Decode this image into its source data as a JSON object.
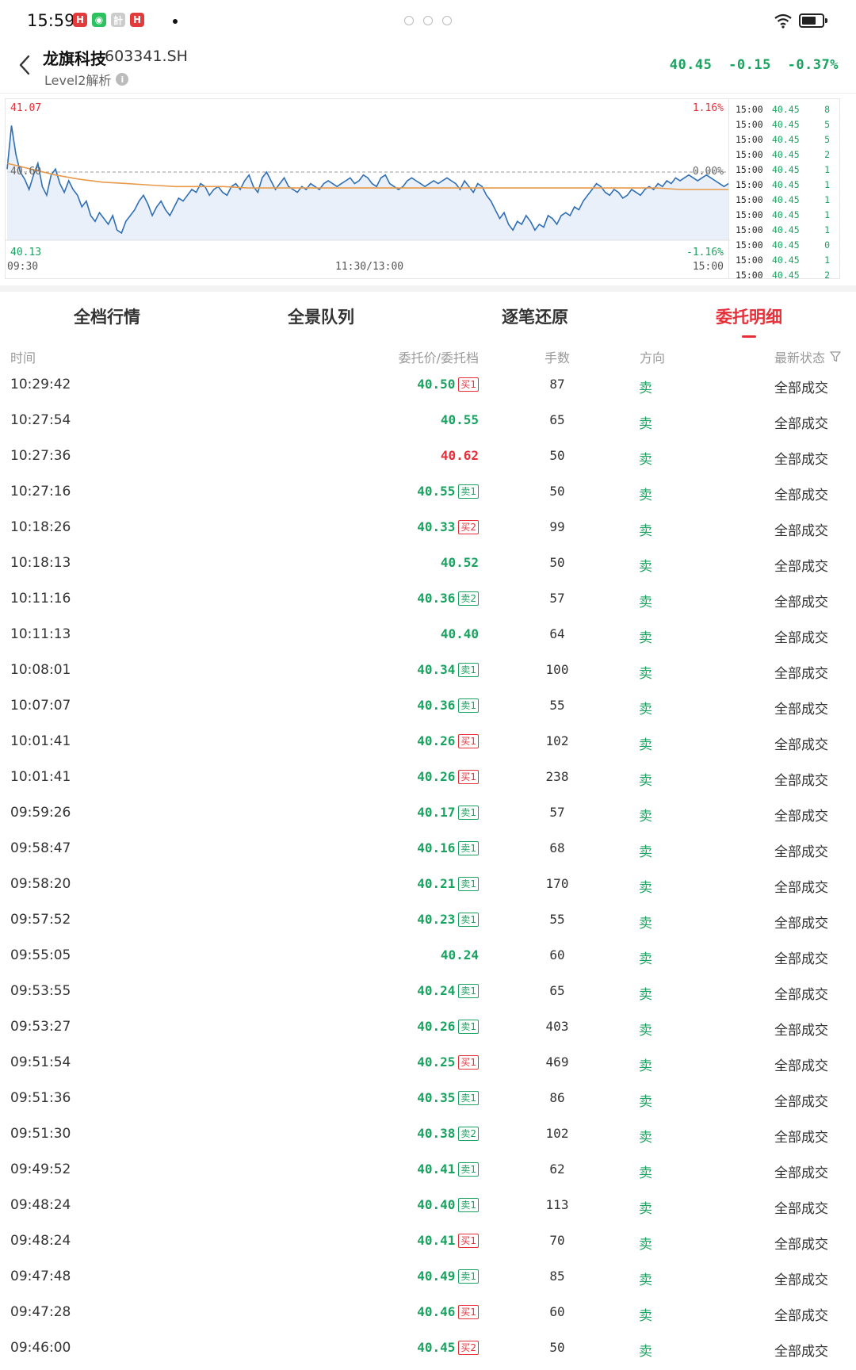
{
  "status_bar": {
    "time": "15:59",
    "apps": [
      {
        "glyph": "H",
        "color": "#e23b3b"
      },
      {
        "glyph": "◉",
        "color": "#2bc25f"
      },
      {
        "glyph": "計",
        "color": "#cccccc"
      },
      {
        "glyph": "H",
        "color": "#e23b3b"
      }
    ]
  },
  "header": {
    "stock_name": "龙旗科技",
    "stock_code": "603341.SH",
    "subtitle": "Level2解析",
    "price": "40.45",
    "change": "-0.15",
    "change_pct": "-0.37%"
  },
  "chart_data": {
    "type": "line",
    "title": "",
    "y_high_label": "41.07",
    "y_low_label": "40.13",
    "y_mid_label": "40.60",
    "pct_high_label": "1.16%",
    "pct_mid_label": "0.00%",
    "pct_low_label": "-1.16%",
    "x_labels": [
      "09:30",
      "11:30/13:00",
      "15:00"
    ],
    "ylim": [
      40.13,
      41.07
    ],
    "reference": 40.6,
    "series": [
      {
        "values": [
          40.62,
          40.92,
          40.72,
          40.6,
          40.55,
          40.48,
          40.58,
          40.66,
          40.5,
          40.44,
          40.58,
          40.62,
          40.52,
          40.46,
          40.54,
          40.48,
          40.44,
          40.36,
          40.4,
          40.3,
          40.26,
          40.32,
          40.28,
          40.24,
          40.3,
          40.2,
          40.18,
          40.26,
          40.3,
          40.34,
          40.4,
          40.44,
          40.38,
          40.3,
          40.36,
          40.4,
          40.34,
          40.3,
          40.36,
          40.42,
          40.4,
          40.44,
          40.48,
          40.46,
          40.52,
          40.5,
          40.44,
          40.48,
          40.5,
          40.46,
          40.44,
          40.5,
          40.52,
          40.48,
          40.54,
          40.58,
          40.5,
          40.46,
          40.56,
          40.6,
          40.54,
          40.48,
          40.52,
          40.56,
          40.5,
          40.48,
          40.46,
          40.5,
          40.48,
          40.52,
          40.5,
          40.48,
          40.52,
          40.54,
          40.52,
          40.5,
          40.52,
          40.54,
          40.56,
          40.52,
          40.54,
          40.58,
          40.56,
          40.52,
          40.5,
          40.56,
          40.58,
          40.52,
          40.5,
          40.48,
          40.5,
          40.54,
          40.56,
          40.54,
          40.52,
          40.5,
          40.52,
          40.54,
          40.52,
          40.54,
          40.56,
          40.54,
          40.52,
          40.48,
          40.54,
          40.5,
          40.46,
          40.52,
          40.5,
          40.44,
          40.4,
          40.34,
          40.28,
          40.32,
          40.24,
          40.2,
          40.26,
          40.24,
          40.3,
          40.26,
          40.2,
          40.24,
          40.22,
          40.3,
          40.28,
          40.24,
          40.3,
          40.32,
          40.3,
          40.36,
          40.34,
          40.4,
          40.44,
          40.48,
          40.52,
          40.5,
          40.46,
          40.44,
          40.48,
          40.46,
          40.42,
          40.44,
          40.48,
          40.46,
          40.44,
          40.48,
          40.5,
          40.48,
          40.52,
          40.5,
          40.54,
          40.52,
          40.56,
          40.54,
          40.56,
          40.58,
          40.56,
          40.54,
          40.56,
          40.58,
          40.56,
          40.54,
          40.52,
          40.5,
          40.52
        ]
      },
      {
        "values": [
          40.66,
          40.62,
          40.58,
          40.55,
          40.53,
          40.52,
          40.51,
          40.5,
          40.5,
          40.5,
          40.49,
          40.49,
          40.49,
          40.49,
          40.49,
          40.49,
          40.49,
          40.49,
          40.49,
          40.49,
          40.49,
          40.49,
          40.49,
          40.49,
          40.49,
          40.49,
          40.49,
          40.49,
          40.48,
          40.48,
          40.48
        ]
      }
    ]
  },
  "tick_panel": [
    {
      "time": "15:00",
      "price": "40.45",
      "vol": "8"
    },
    {
      "time": "15:00",
      "price": "40.45",
      "vol": "5"
    },
    {
      "time": "15:00",
      "price": "40.45",
      "vol": "5"
    },
    {
      "time": "15:00",
      "price": "40.45",
      "vol": "2"
    },
    {
      "time": "15:00",
      "price": "40.45",
      "vol": "1"
    },
    {
      "time": "15:00",
      "price": "40.45",
      "vol": "1"
    },
    {
      "time": "15:00",
      "price": "40.45",
      "vol": "1"
    },
    {
      "time": "15:00",
      "price": "40.45",
      "vol": "1"
    },
    {
      "time": "15:00",
      "price": "40.45",
      "vol": "1"
    },
    {
      "time": "15:00",
      "price": "40.45",
      "vol": "0"
    },
    {
      "time": "15:00",
      "price": "40.45",
      "vol": "1"
    },
    {
      "time": "15:00",
      "price": "40.45",
      "vol": "2"
    }
  ],
  "tabs": [
    "全档行情",
    "全景队列",
    "逐笔还原",
    "委托明细"
  ],
  "active_tab": 3,
  "table": {
    "headers": {
      "time": "时间",
      "price": "委托价/委托档",
      "qty": "手数",
      "dir": "方向",
      "status": "最新状态"
    },
    "rows": [
      {
        "time": "10:29:42",
        "price": "40.50",
        "price_color": "green",
        "badge": "买1",
        "badge_type": "buy",
        "qty": "87",
        "dir": "卖",
        "status": "全部成交"
      },
      {
        "time": "10:27:54",
        "price": "40.55",
        "price_color": "green",
        "badge": "",
        "badge_type": "",
        "qty": "65",
        "dir": "卖",
        "status": "全部成交"
      },
      {
        "time": "10:27:36",
        "price": "40.62",
        "price_color": "red",
        "badge": "",
        "badge_type": "",
        "qty": "50",
        "dir": "卖",
        "status": "全部成交"
      },
      {
        "time": "10:27:16",
        "price": "40.55",
        "price_color": "green",
        "badge": "卖1",
        "badge_type": "sell",
        "qty": "50",
        "dir": "卖",
        "status": "全部成交"
      },
      {
        "time": "10:18:26",
        "price": "40.33",
        "price_color": "green",
        "badge": "买2",
        "badge_type": "buy",
        "qty": "99",
        "dir": "卖",
        "status": "全部成交"
      },
      {
        "time": "10:18:13",
        "price": "40.52",
        "price_color": "green",
        "badge": "",
        "badge_type": "",
        "qty": "50",
        "dir": "卖",
        "status": "全部成交"
      },
      {
        "time": "10:11:16",
        "price": "40.36",
        "price_color": "green",
        "badge": "卖2",
        "badge_type": "sell",
        "qty": "57",
        "dir": "卖",
        "status": "全部成交"
      },
      {
        "time": "10:11:13",
        "price": "40.40",
        "price_color": "green",
        "badge": "",
        "badge_type": "",
        "qty": "64",
        "dir": "卖",
        "status": "全部成交"
      },
      {
        "time": "10:08:01",
        "price": "40.34",
        "price_color": "green",
        "badge": "卖1",
        "badge_type": "sell",
        "qty": "100",
        "dir": "卖",
        "status": "全部成交"
      },
      {
        "time": "10:07:07",
        "price": "40.36",
        "price_color": "green",
        "badge": "卖1",
        "badge_type": "sell",
        "qty": "55",
        "dir": "卖",
        "status": "全部成交"
      },
      {
        "time": "10:01:41",
        "price": "40.26",
        "price_color": "green",
        "badge": "买1",
        "badge_type": "buy",
        "qty": "102",
        "dir": "卖",
        "status": "全部成交"
      },
      {
        "time": "10:01:41",
        "price": "40.26",
        "price_color": "green",
        "badge": "买1",
        "badge_type": "buy",
        "qty": "238",
        "dir": "卖",
        "status": "全部成交"
      },
      {
        "time": "09:59:26",
        "price": "40.17",
        "price_color": "green",
        "badge": "卖1",
        "badge_type": "sell",
        "qty": "57",
        "dir": "卖",
        "status": "全部成交"
      },
      {
        "time": "09:58:47",
        "price": "40.16",
        "price_color": "green",
        "badge": "卖1",
        "badge_type": "sell",
        "qty": "68",
        "dir": "卖",
        "status": "全部成交"
      },
      {
        "time": "09:58:20",
        "price": "40.21",
        "price_color": "green",
        "badge": "卖1",
        "badge_type": "sell",
        "qty": "170",
        "dir": "卖",
        "status": "全部成交"
      },
      {
        "time": "09:57:52",
        "price": "40.23",
        "price_color": "green",
        "badge": "卖1",
        "badge_type": "sell",
        "qty": "55",
        "dir": "卖",
        "status": "全部成交"
      },
      {
        "time": "09:55:05",
        "price": "40.24",
        "price_color": "green",
        "badge": "",
        "badge_type": "",
        "qty": "60",
        "dir": "卖",
        "status": "全部成交"
      },
      {
        "time": "09:53:55",
        "price": "40.24",
        "price_color": "green",
        "badge": "卖1",
        "badge_type": "sell",
        "qty": "65",
        "dir": "卖",
        "status": "全部成交"
      },
      {
        "time": "09:53:27",
        "price": "40.26",
        "price_color": "green",
        "badge": "卖1",
        "badge_type": "sell",
        "qty": "403",
        "dir": "卖",
        "status": "全部成交"
      },
      {
        "time": "09:51:54",
        "price": "40.25",
        "price_color": "green",
        "badge": "买1",
        "badge_type": "buy",
        "qty": "469",
        "dir": "卖",
        "status": "全部成交"
      },
      {
        "time": "09:51:36",
        "price": "40.35",
        "price_color": "green",
        "badge": "卖1",
        "badge_type": "sell",
        "qty": "86",
        "dir": "卖",
        "status": "全部成交"
      },
      {
        "time": "09:51:30",
        "price": "40.38",
        "price_color": "green",
        "badge": "卖2",
        "badge_type": "sell",
        "qty": "102",
        "dir": "卖",
        "status": "全部成交"
      },
      {
        "time": "09:49:52",
        "price": "40.41",
        "price_color": "green",
        "badge": "卖1",
        "badge_type": "sell",
        "qty": "62",
        "dir": "卖",
        "status": "全部成交"
      },
      {
        "time": "09:48:24",
        "price": "40.40",
        "price_color": "green",
        "badge": "卖1",
        "badge_type": "sell",
        "qty": "113",
        "dir": "卖",
        "status": "全部成交"
      },
      {
        "time": "09:48:24",
        "price": "40.41",
        "price_color": "green",
        "badge": "买1",
        "badge_type": "buy",
        "qty": "70",
        "dir": "卖",
        "status": "全部成交"
      },
      {
        "time": "09:47:48",
        "price": "40.49",
        "price_color": "green",
        "badge": "卖1",
        "badge_type": "sell",
        "qty": "85",
        "dir": "卖",
        "status": "全部成交"
      },
      {
        "time": "09:47:28",
        "price": "40.46",
        "price_color": "green",
        "badge": "买1",
        "badge_type": "buy",
        "qty": "60",
        "dir": "卖",
        "status": "全部成交"
      },
      {
        "time": "09:46:00",
        "price": "40.45",
        "price_color": "green",
        "badge": "买2",
        "badge_type": "buy",
        "qty": "50",
        "dir": "卖",
        "status": "全部成交"
      }
    ]
  },
  "colors": {
    "up": "#e5303a",
    "down": "#1aa260",
    "line": "#2f6fb5",
    "avg": "#e89a4a"
  },
  "icons": {
    "back": "chevron-left-icon",
    "info": "info-icon",
    "filter": "filter-icon",
    "wifi": "wifi-icon",
    "battery": "battery-icon"
  }
}
